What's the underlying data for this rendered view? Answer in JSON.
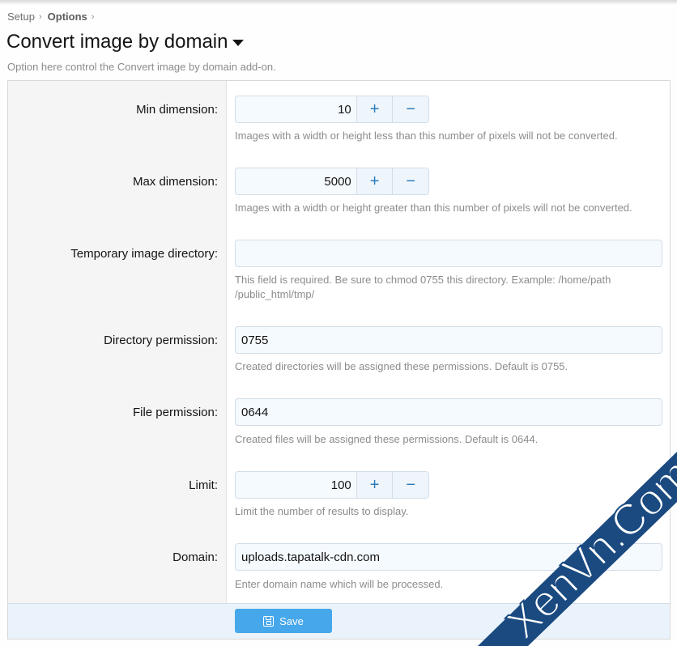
{
  "breadcrumb": {
    "items": [
      "Setup",
      "Options"
    ]
  },
  "header": {
    "title": "Convert image by domain",
    "description": "Option here control the Convert image by domain add-on."
  },
  "options": {
    "min_dimension": {
      "label": "Min dimension:",
      "value": "10",
      "hint": "Images with a width or height less than this number of pixels will not be converted."
    },
    "max_dimension": {
      "label": "Max dimension:",
      "value": "5000",
      "hint": "Images with a width or height greater than this number of pixels will not be converted."
    },
    "temp_dir": {
      "label": "Temporary image directory:",
      "value": "",
      "hint_line1": "This field is required. Be sure to chmod 0755 this directory. Example: /home/path",
      "hint_line2": "/public_html/tmp/"
    },
    "dir_permission": {
      "label": "Directory permission:",
      "value": "0755",
      "hint": "Created directories will be assigned these permissions. Default is 0755."
    },
    "file_permission": {
      "label": "File permission:",
      "value": "0644",
      "hint": "Created files will be assigned these permissions. Default is 0644."
    },
    "limit": {
      "label": "Limit:",
      "value": "100",
      "hint": "Limit the number of results to display."
    },
    "domain": {
      "label": "Domain:",
      "value": "uploads.tapatalk-cdn.com",
      "hint": "Enter domain name which will be processed."
    }
  },
  "stepper": {
    "plus": "+",
    "minus": "−"
  },
  "footer": {
    "save_label": "Save"
  },
  "watermark": {
    "text": "XenVn.Com",
    "color": "#1a4a80"
  },
  "colors": {
    "accent": "#47a7eb",
    "input_bg": "#f5faff"
  }
}
